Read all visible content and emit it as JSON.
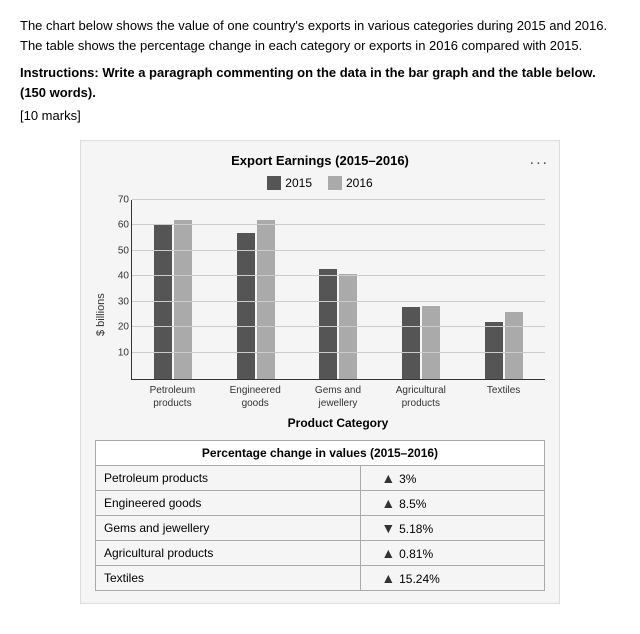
{
  "intro": {
    "text1": "The chart below shows the value of one country's exports in various categories during 2015 and 2016. The table shows the percentage change in each category or exports in 2016 compared with 2015.",
    "instructions": "Instructions: Write a paragraph commenting on the data in the bar graph and the table below. (150 words).",
    "marks": "[10 marks]"
  },
  "chart": {
    "title": "Export Earnings (2015–2016)",
    "three_dots": "...",
    "legend": [
      {
        "label": "2015",
        "color": "#555555"
      },
      {
        "label": "2016",
        "color": "#aaaaaa"
      }
    ],
    "y_axis_label": "$ billions",
    "y_ticks": [
      10,
      20,
      30,
      40,
      50,
      60,
      70
    ],
    "x_axis_title": "Product Category",
    "categories": [
      {
        "name_line1": "Petroleum",
        "name_line2": "products",
        "val2015": 60,
        "val2016": 62
      },
      {
        "name_line1": "Engineered",
        "name_line2": "goods",
        "val2015": 57,
        "val2016": 62
      },
      {
        "name_line1": "Gems and",
        "name_line2": "jewellery",
        "val2015": 43,
        "val2016": 41
      },
      {
        "name_line1": "Agricultural",
        "name_line2": "products",
        "val2015": 28,
        "val2016": 28.5
      },
      {
        "name_line1": "Textiles",
        "name_line2": "",
        "val2015": 22,
        "val2016": 26
      }
    ]
  },
  "table": {
    "header": "Percentage change in values (2015–2016)",
    "rows": [
      {
        "category": "Petroleum products",
        "direction": "up",
        "value": "3%"
      },
      {
        "category": "Engineered goods",
        "direction": "up",
        "value": "8.5%"
      },
      {
        "category": "Gems and jewellery",
        "direction": "down",
        "value": "5.18%"
      },
      {
        "category": "Agricultural products",
        "direction": "up",
        "value": "0.81%"
      },
      {
        "category": "Textiles",
        "direction": "up",
        "value": "15.24%"
      }
    ]
  }
}
